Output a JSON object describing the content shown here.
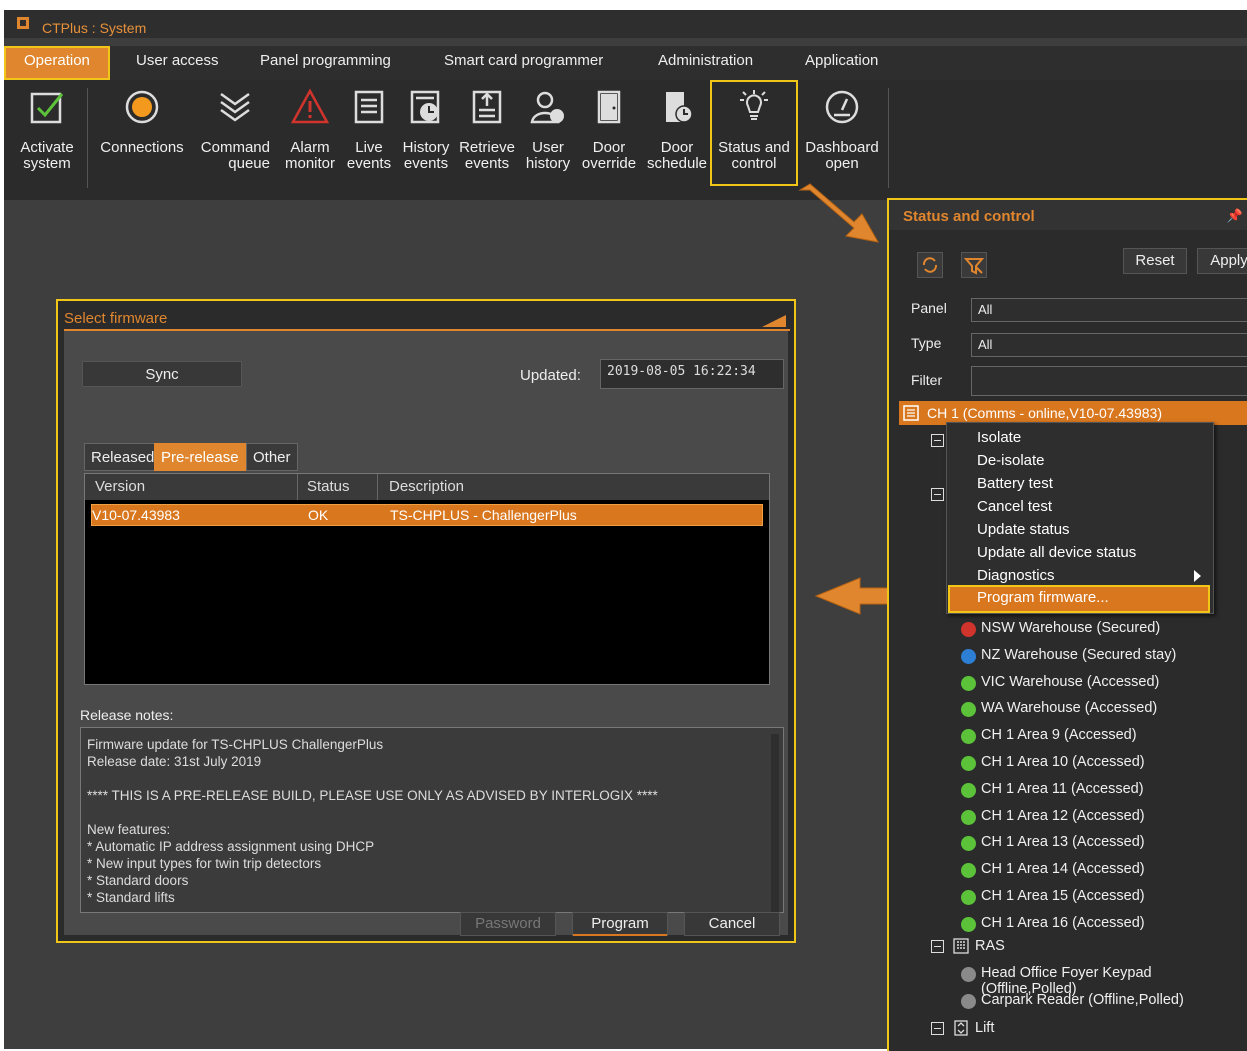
{
  "app": {
    "title": "CTPlus : System"
  },
  "menu": [
    "Operation",
    "User access",
    "Panel programming",
    "Smart card programmer",
    "Administration",
    "Application"
  ],
  "ribbon": {
    "activate": "Activate\nsystem",
    "connections": "Connections",
    "command": "Command\nqueue",
    "alarm": "Alarm\nmonitor",
    "live": "Live\nevents",
    "history": "History\nevents",
    "retrieve": "Retrieve\nevents",
    "user": "User\nhistory",
    "override": "Door\noverride",
    "schedule": "Door\nschedule",
    "status": "Status and\ncontrol",
    "dashboard": "Dashboard\nopen"
  },
  "firmware": {
    "title": "Select firmware",
    "sync": "Sync",
    "updated_label": "Updated:",
    "updated_value": "2019-08-05 16:22:34",
    "tabs": [
      "Released",
      "Pre-release",
      "Other"
    ],
    "columns": [
      "Version",
      "Status",
      "Description"
    ],
    "row": {
      "version": "V10-07.43983",
      "status": "OK",
      "description": "TS-CHPLUS - ChallengerPlus"
    },
    "notes_label": "Release notes:",
    "notes": "Firmware update for TS-CHPLUS ChallengerPlus\nRelease date: 31st July 2019\n\n**** THIS IS A PRE-RELEASE BUILD, PLEASE USE ONLY AS ADVISED BY INTERLOGIX ****\n\nNew features:\n* Automatic IP address assignment using DHCP\n* New input types for twin trip detectors\n* Standard doors\n* Standard lifts",
    "password": "Password",
    "program": "Program",
    "cancel": "Cancel"
  },
  "status": {
    "title": "Status and control",
    "reset": "Reset",
    "apply": "Apply",
    "panel_label": "Panel",
    "panel_value": "All",
    "type_label": "Type",
    "type_value": "All",
    "filter_label": "Filter",
    "selected": "CH 1 (Comms - online,V10-07.43983)"
  },
  "context_menu": [
    "Isolate",
    "De-isolate",
    "Battery test",
    "Cancel test",
    "Update status",
    "Update all device status",
    "Diagnostics",
    "Program firmware..."
  ],
  "tree": [
    {
      "label": "NSW Warehouse (Secured)",
      "color": "#d0342c"
    },
    {
      "label": "NZ Warehouse (Secured stay)",
      "color": "#2d7fd6"
    },
    {
      "label": "VIC Warehouse (Accessed)",
      "color": "#5cc23a"
    },
    {
      "label": "WA Warehouse (Accessed)",
      "color": "#5cc23a"
    },
    {
      "label": "CH 1 Area 9 (Accessed)",
      "color": "#5cc23a"
    },
    {
      "label": "CH 1 Area 10 (Accessed)",
      "color": "#5cc23a"
    },
    {
      "label": "CH 1 Area 11 (Accessed)",
      "color": "#5cc23a"
    },
    {
      "label": "CH 1 Area 12 (Accessed)",
      "color": "#5cc23a"
    },
    {
      "label": "CH 1 Area 13 (Accessed)",
      "color": "#5cc23a"
    },
    {
      "label": "CH 1 Area 14 (Accessed)",
      "color": "#5cc23a"
    },
    {
      "label": "CH 1 Area 15 (Accessed)",
      "color": "#5cc23a"
    },
    {
      "label": "CH 1 Area 16 (Accessed)",
      "color": "#5cc23a"
    }
  ],
  "ras": {
    "label": "RAS",
    "items": [
      "Head Office Foyer Keypad (Offline,Polled)",
      "Carpark Reader (Offline,Polled)"
    ]
  },
  "lift": {
    "label": "Lift"
  }
}
